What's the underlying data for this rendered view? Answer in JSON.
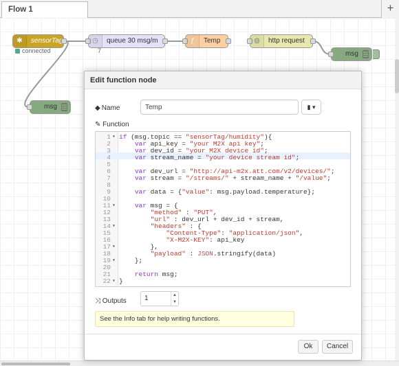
{
  "tabs": [
    {
      "label": "Flow 1"
    }
  ],
  "add_tab_label": "+",
  "nodes": {
    "sensortag": {
      "label": "sensorTag",
      "status": "connected",
      "color": "#c9a427"
    },
    "queue": {
      "label": "queue 30 msg/m",
      "count": "7",
      "color": "#e6e0f8"
    },
    "temp": {
      "label": "Temp",
      "color": "#fdd0a2"
    },
    "http": {
      "label": "http request",
      "color": "#e7e7ae"
    },
    "msg_right": {
      "label": "msg",
      "color": "#87a980"
    },
    "msg_left": {
      "label": "msg",
      "color": "#87a980"
    }
  },
  "dialog": {
    "title": "Edit function node",
    "name_label": "Name",
    "name_value": "Temp",
    "function_label": "Function",
    "outputs_label": "Outputs",
    "outputs_value": "1",
    "tip": "See the Info tab for help writing functions.",
    "ok": "Ok",
    "cancel": "Cancel"
  },
  "code_lines": [
    {
      "n": "1",
      "fold": "▾",
      "text": "if (msg.topic == \"sensorTag/humidity\"){"
    },
    {
      "n": "2",
      "fold": "",
      "text": "    var api_key = \"your M2X api key\";"
    },
    {
      "n": "3",
      "fold": "",
      "text": "    var dev_id = \"your M2X device id\";"
    },
    {
      "n": "4",
      "fold": "",
      "text": "    var stream_name = \"your device stream id\";"
    },
    {
      "n": "5",
      "fold": "",
      "text": ""
    },
    {
      "n": "6",
      "fold": "",
      "text": "    var dev_url = \"http://api-m2x.att.com/v2/devices/\";"
    },
    {
      "n": "7",
      "fold": "",
      "text": "    var stream = \"/streams/\" + stream_name + \"/value\";"
    },
    {
      "n": "8",
      "fold": "",
      "text": ""
    },
    {
      "n": "9",
      "fold": "",
      "text": "    var data = {\"value\": msg.payload.temperature};"
    },
    {
      "n": "10",
      "fold": "",
      "text": ""
    },
    {
      "n": "11",
      "fold": "▾",
      "text": "    var msg = {"
    },
    {
      "n": "12",
      "fold": "",
      "text": "        \"method\" : \"PUT\","
    },
    {
      "n": "13",
      "fold": "",
      "text": "        \"url\" : dev_url + dev_id + stream,"
    },
    {
      "n": "14",
      "fold": "▾",
      "text": "        \"headers\" : {"
    },
    {
      "n": "15",
      "fold": "",
      "text": "            \"Content-Type\": \"application/json\","
    },
    {
      "n": "16",
      "fold": "",
      "text": "            \"X-M2X-KEY\": api_key"
    },
    {
      "n": "17",
      "fold": "▾",
      "text": "        },"
    },
    {
      "n": "18",
      "fold": "",
      "text": "        \"payload\" : JSON.stringify(data)"
    },
    {
      "n": "19",
      "fold": "▾",
      "text": "    };"
    },
    {
      "n": "20",
      "fold": "",
      "text": ""
    },
    {
      "n": "21",
      "fold": "",
      "text": "    return msg;"
    },
    {
      "n": "22",
      "fold": "▾",
      "text": "}"
    }
  ]
}
